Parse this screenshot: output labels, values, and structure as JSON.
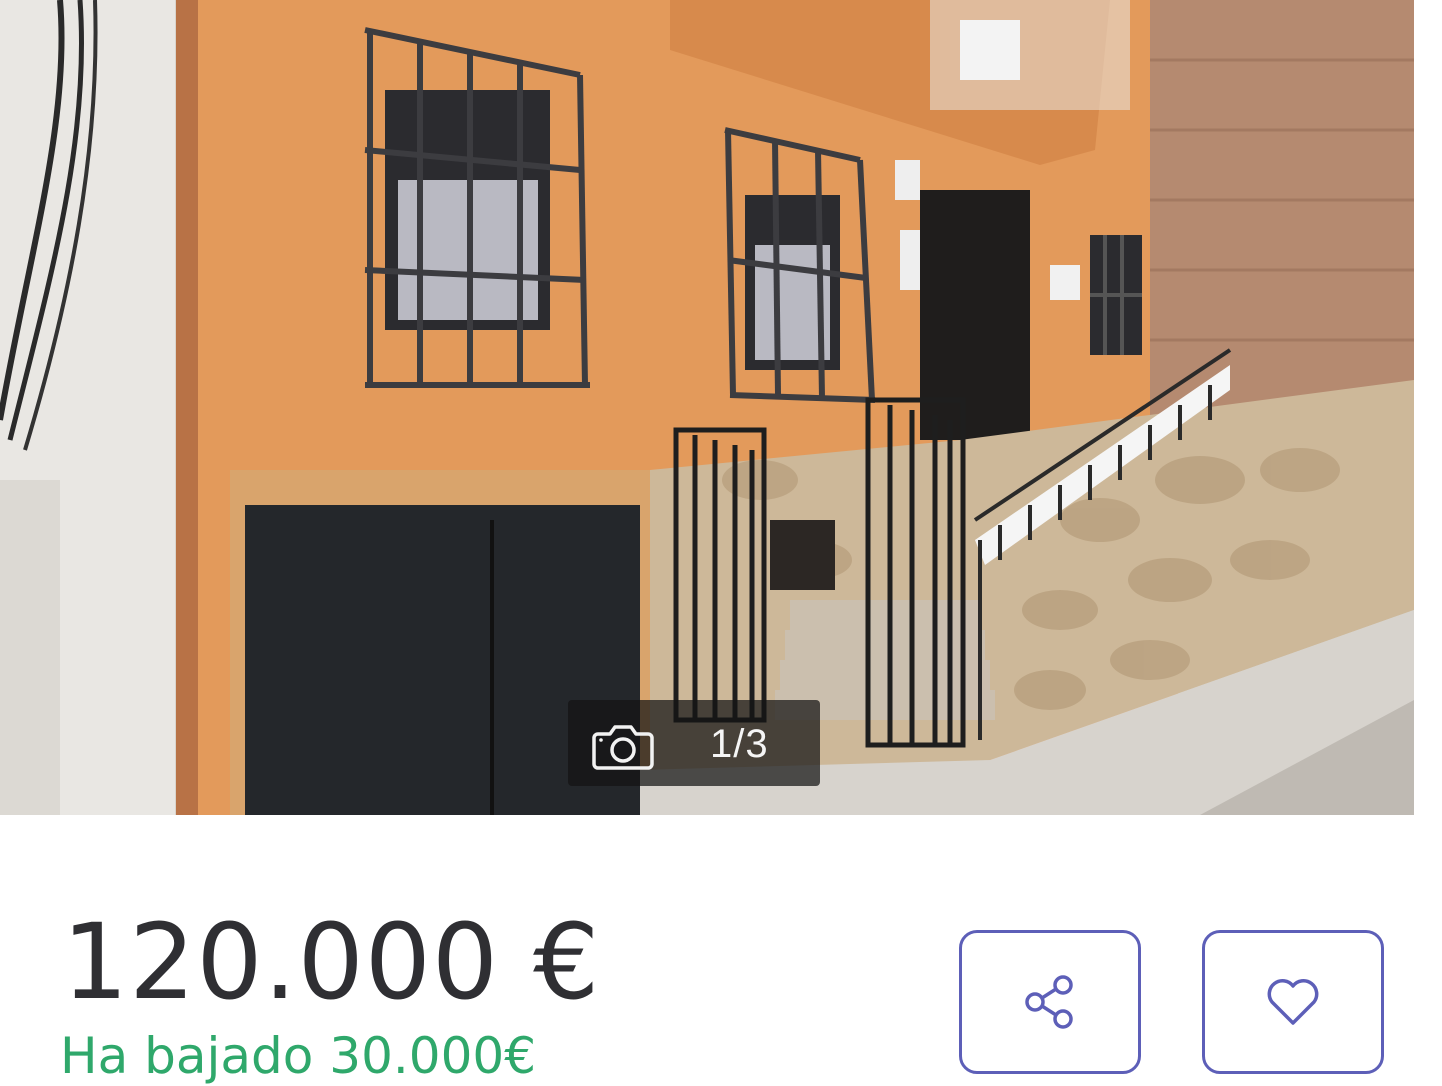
{
  "listing": {
    "photo": {
      "alt_subject": "building-facade-photo",
      "counter_text": "1/3",
      "counter_icon": "camera-icon"
    },
    "price": "120.000 €",
    "price_drop": "Ha bajado 30.000€",
    "actions": {
      "share_icon": "share-icon",
      "favorite_icon": "heart-icon"
    }
  },
  "colors": {
    "accent_border": "#5d5fb8",
    "price_text": "#2f2f33",
    "price_drop_text": "#2fa86b",
    "facade": "#e39a5b"
  }
}
